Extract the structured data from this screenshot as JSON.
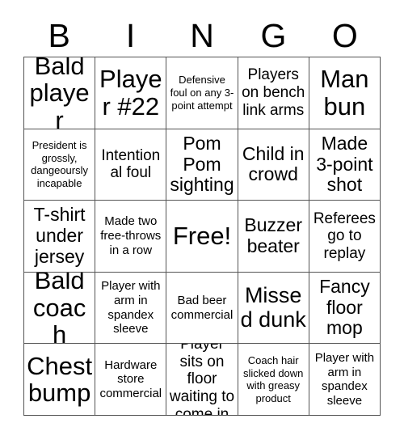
{
  "header": {
    "letters": [
      "B",
      "I",
      "N",
      "G",
      "O"
    ]
  },
  "grid": {
    "rows": [
      [
        {
          "text": "Bald player",
          "size": "xxl"
        },
        {
          "text": "Player #22",
          "size": "xxl"
        },
        {
          "text": "Defensive foul on any 3-point attempt",
          "size": "xs"
        },
        {
          "text": "Players on bench link arms",
          "size": "md"
        },
        {
          "text": "Man bun",
          "size": "xxl"
        }
      ],
      [
        {
          "text": "President is grossly, dangeoursly incapable",
          "size": "xs"
        },
        {
          "text": "Intentional foul",
          "size": "md"
        },
        {
          "text": "Pom Pom sighting",
          "size": "lg"
        },
        {
          "text": "Child in crowd",
          "size": "lg"
        },
        {
          "text": "Made 3-point shot",
          "size": "lg"
        }
      ],
      [
        {
          "text": "T-shirt under jersey",
          "size": "lg"
        },
        {
          "text": "Made two free-throws in a row",
          "size": "sm"
        },
        {
          "text": "Free!",
          "size": "free"
        },
        {
          "text": "Buzzer beater",
          "size": "lg"
        },
        {
          "text": "Referees go to replay",
          "size": "md"
        }
      ],
      [
        {
          "text": "Bald coach",
          "size": "xxl"
        },
        {
          "text": "Player with arm in spandex sleeve",
          "size": "sm"
        },
        {
          "text": "Bad beer commercial",
          "size": "sm"
        },
        {
          "text": "Missed dunk",
          "size": "xl"
        },
        {
          "text": "Fancy floor mop",
          "size": "lg"
        }
      ],
      [
        {
          "text": "Chest bump",
          "size": "xxl"
        },
        {
          "text": "Hardware store commercial",
          "size": "sm"
        },
        {
          "text": "Player sits on floor waiting to come in",
          "size": "md"
        },
        {
          "text": "Coach hair slicked down with greasy product",
          "size": "xs"
        },
        {
          "text": "Player with arm in spandex sleeve",
          "size": "sm"
        }
      ]
    ]
  },
  "colors": {
    "background": "#ffffff",
    "text": "#000000",
    "border": "#555555"
  }
}
